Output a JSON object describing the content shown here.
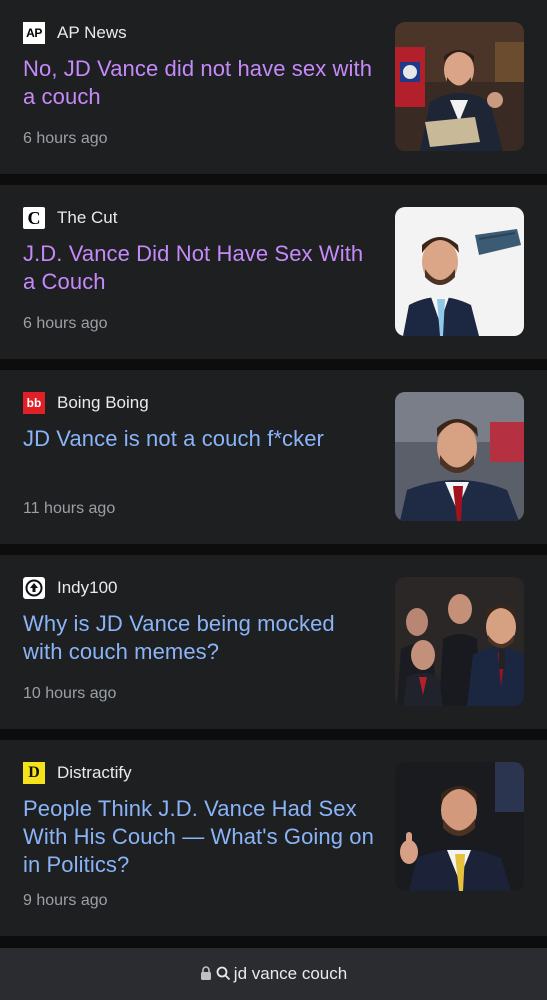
{
  "articles": [
    {
      "source": "AP News",
      "logo_icon": "ap-news-logo",
      "logo_text": "AP",
      "headline": "No, JD Vance did not have sex with a couch",
      "time": "6 hours ago",
      "visited": true
    },
    {
      "source": "The Cut",
      "logo_icon": "the-cut-logo",
      "logo_text": "C",
      "headline": "J.D. Vance Did Not Have Sex With a Couch",
      "time": "6 hours ago",
      "visited": true
    },
    {
      "source": "Boing Boing",
      "logo_icon": "boing-boing-logo",
      "logo_text": "bb",
      "headline": "JD Vance is not a couch f*cker",
      "time": "11 hours ago",
      "visited": false
    },
    {
      "source": "Indy100",
      "logo_icon": "indy100-logo",
      "logo_text": "",
      "headline": "Why is JD Vance being mocked with couch memes?",
      "time": "10 hours ago",
      "visited": false
    },
    {
      "source": "Distractify",
      "logo_icon": "distractify-logo",
      "logo_text": "D",
      "headline": "People Think J.D. Vance Had Sex With His Couch — What's Going on in Politics?",
      "time": "9 hours ago",
      "visited": false
    }
  ],
  "address_bar": {
    "lock_icon": "lock-icon",
    "search_icon": "search-icon",
    "query": "jd vance couch"
  },
  "colors": {
    "visited_link": "#c58af9",
    "link": "#8ab4f8",
    "card_bg": "#1e1f21",
    "page_bg": "#0d0d0e"
  }
}
